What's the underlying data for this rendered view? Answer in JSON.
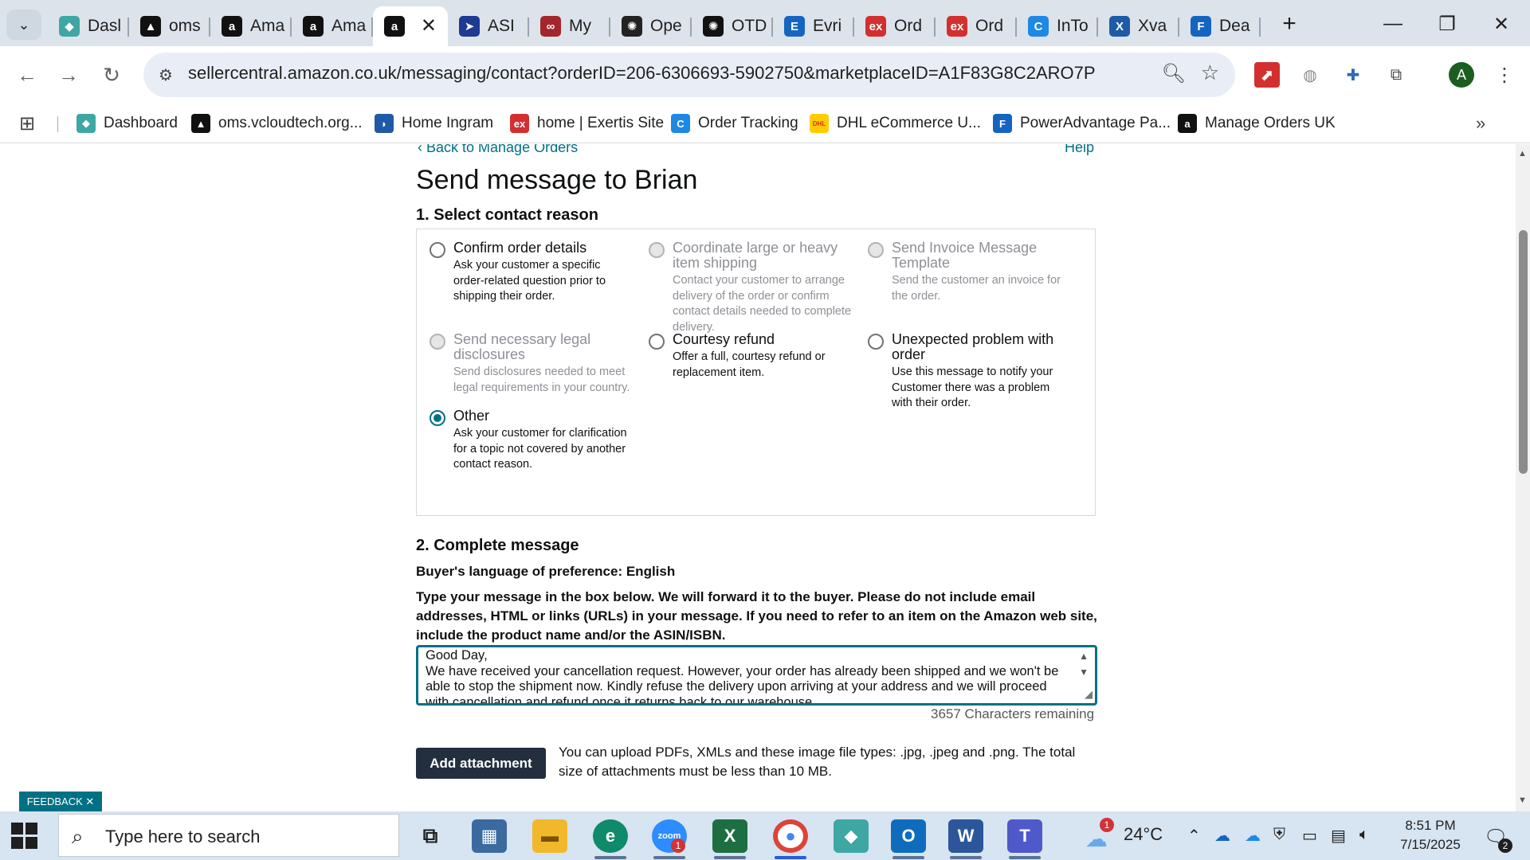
{
  "browser": {
    "tabs": [
      {
        "label": "Dasl",
        "icon": "hexagon-icon",
        "color": "#3fa7a3"
      },
      {
        "label": "oms",
        "icon": "triangle-logo-icon",
        "color": "#111111"
      },
      {
        "label": "Ama",
        "icon": "amazon-icon",
        "color": "#111111"
      },
      {
        "label": "Ama",
        "icon": "amazon-icon",
        "color": "#111111"
      },
      {
        "label": "",
        "icon": "amazon-icon",
        "color": "#111111",
        "active": true
      },
      {
        "label": "ASI",
        "icon": "arrow-logo-icon",
        "color": "#1f3a93"
      },
      {
        "label": "My",
        "icon": "link-logo-icon",
        "color": "#a4262c"
      },
      {
        "label": "Ope",
        "icon": "openai-icon",
        "color": "#222222"
      },
      {
        "label": "OTD",
        "icon": "openai-icon",
        "color": "#111111"
      },
      {
        "label": "Evri",
        "icon": "e-logo-icon",
        "color": "#1565c0"
      },
      {
        "label": "Ord",
        "icon": "exertis-icon",
        "color": "#d32f2f"
      },
      {
        "label": "Ord",
        "icon": "exertis-icon",
        "color": "#d32f2f"
      },
      {
        "label": "InTo",
        "icon": "c-logo-icon",
        "color": "#1e88e5"
      },
      {
        "label": "Xva",
        "icon": "x-logo-icon",
        "color": "#1e5aa8"
      },
      {
        "label": "Dea",
        "icon": "doc-logo-icon",
        "color": "#1565c0"
      }
    ],
    "url": "sellercentral.amazon.co.uk/messaging/contact?orderID=206-6306693-5902750&marketplaceID=A1F83G8C2ARO7P",
    "profile_initial": "A",
    "bookmarks": [
      {
        "label": "Dashboard",
        "color": "#3fa7a3",
        "glyph": "◆"
      },
      {
        "label": "oms.vcloudtech.org...",
        "color": "#111111",
        "glyph": "▲"
      },
      {
        "label": "Home Ingram",
        "color": "#1e5aa8",
        "glyph": "◗"
      },
      {
        "label": "home | Exertis Site",
        "color": "#d32f2f",
        "glyph": "ex"
      },
      {
        "label": "Order Tracking",
        "color": "#1e88e5",
        "glyph": "C"
      },
      {
        "label": "DHL eCommerce U...",
        "color": "#ffcc00",
        "glyph": "DHL"
      },
      {
        "label": "PowerAdvantage Pa...",
        "color": "#1565c0",
        "glyph": "F"
      },
      {
        "label": "Manage Orders UK",
        "color": "#111111",
        "glyph": "a"
      }
    ]
  },
  "page": {
    "back_link": "‹ Back to Manage Orders",
    "help_link": "Help",
    "title": "Send message to Brian",
    "section1": "1. Select contact reason",
    "options": [
      {
        "label": "Confirm order details",
        "desc": "Ask your customer a specific order-related question prior to shipping their order.",
        "state": "enabled"
      },
      {
        "label": "Coordinate large or heavy item shipping",
        "desc": "Contact your customer to arrange delivery of the order or confirm contact details needed to complete delivery.",
        "state": "disabled"
      },
      {
        "label": "Send Invoice Message Template",
        "desc": "Send the customer an invoice for the order.",
        "state": "disabled"
      },
      {
        "label": "Send necessary legal disclosures",
        "desc": "Send disclosures needed to meet legal requirements in your country.",
        "state": "disabled"
      },
      {
        "label": "Courtesy refund",
        "desc": "Offer a full, courtesy refund or replacement item.",
        "state": "enabled"
      },
      {
        "label": "Unexpected problem with order",
        "desc": "Use this message to notify your Customer there was a problem with their order.",
        "state": "enabled"
      },
      {
        "label": "Other",
        "desc": "Ask your customer for clarification for a topic not covered by another contact reason.",
        "state": "selected"
      }
    ],
    "section2": "2. Complete message",
    "language_pref": "Buyer's language of preference: English",
    "instructions": "Type your message in the box below. We will forward it to the buyer. Please do not include email addresses, HTML or links (URLs) in your message. If you need to refer to an item on the Amazon web site, include the product name and/or the ASIN/ISBN.",
    "message": "Good Day,\nWe have received your cancellation request. However, your order has already been shipped and we won't be able to stop the shipment now. Kindly refuse the delivery upon arriving at your address and we will proceed with cancellation and refund once it returns back to our warehouse.",
    "chars_remaining": "3657 Characters remaining",
    "attach_label": "Add attachment",
    "attach_note": "You can upload PDFs, XMLs and these image file types: .jpg, .jpeg and .png. The total size of attachments must be less than 10 MB.",
    "feedback_label": "FEEDBACK ✕"
  },
  "taskbar": {
    "search_placeholder": "Type here to search",
    "weather": "24°C",
    "time": "8:51 PM",
    "date": "7/15/2025",
    "zoom_badge": "1",
    "weather_badge": "1",
    "notif_count": "2",
    "colors": {
      "excel": "#1d6f42",
      "word": "#2b579a",
      "outlook": "#0f6cbd",
      "teams": "#5059c9",
      "zoom": "#2d8cff"
    }
  }
}
